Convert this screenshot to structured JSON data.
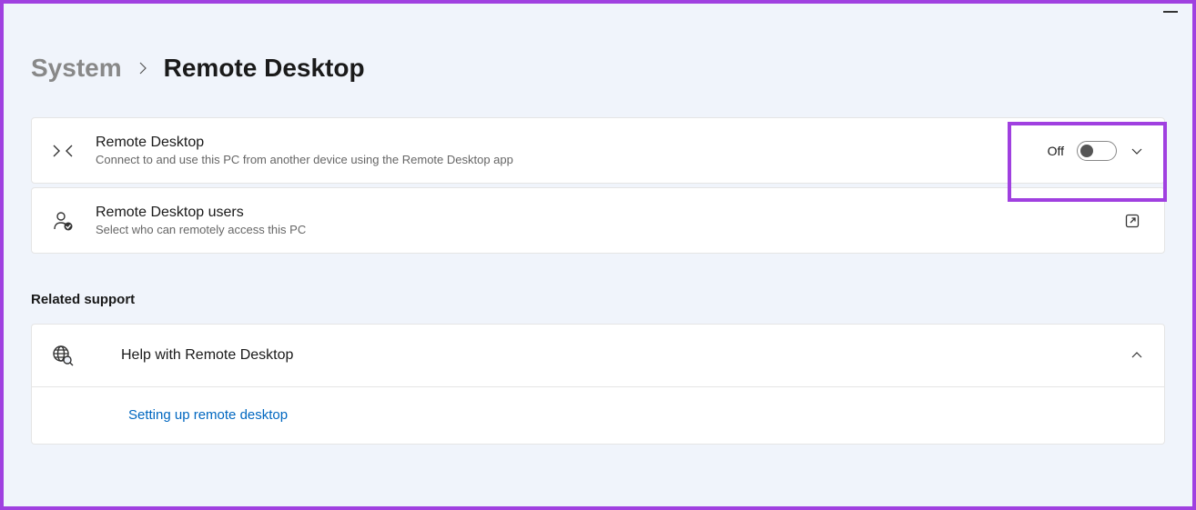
{
  "breadcrumb": {
    "parent": "System",
    "current": "Remote Desktop"
  },
  "cards": {
    "remoteDesktop": {
      "title": "Remote Desktop",
      "subtitle": "Connect to and use this PC from another device using the Remote Desktop app",
      "toggleLabel": "Off"
    },
    "remoteDesktopUsers": {
      "title": "Remote Desktop users",
      "subtitle": "Select who can remotely access this PC"
    }
  },
  "relatedSupport": {
    "heading": "Related support",
    "help": {
      "title": "Help with Remote Desktop"
    },
    "link": "Setting up remote desktop"
  }
}
